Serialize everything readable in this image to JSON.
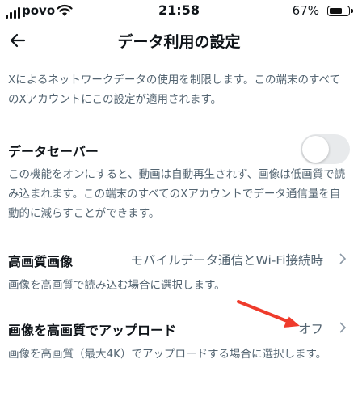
{
  "status_bar": {
    "carrier": "povo",
    "time": "21:58",
    "battery": "67%",
    "battery_level": 0.67
  },
  "header": {
    "title": "データ利用の設定"
  },
  "intro": {
    "line1": "Xによるネットワークデータの使用を制限します。この端末のすべて",
    "line2": "のXアカウントにこの設定が適用されます。"
  },
  "data_saver": {
    "label": "データセーバー",
    "enabled": false,
    "desc_line1": "この機能をオンにすると、動画は自動再生されず、画像は低画質で読",
    "desc_line2": "み込まれます。この端末のすべてのXアカウントでデータ通信量を自",
    "desc_line3": "動的に減らすことができます。"
  },
  "hq_images": {
    "label": "高画質画像",
    "value": "モバイルデータ通信とWi-Fi接続時",
    "desc": "画像を高画質で読み込む場合に選択します。"
  },
  "hq_upload": {
    "label": "画像を高画質でアップロード",
    "value": "オフ",
    "desc": "画像を高画質（最大4K）でアップロードする場合に選択します。"
  },
  "annotation": {
    "color": "#ef3b2c"
  }
}
